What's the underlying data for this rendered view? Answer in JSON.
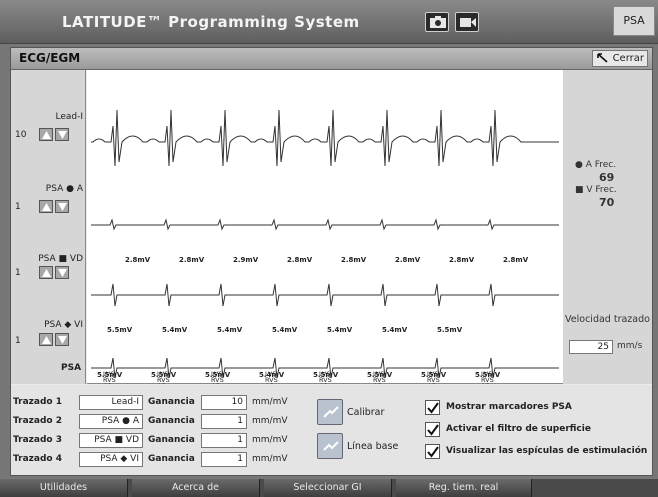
{
  "header": {
    "title": "LATITUDE™ Programming System",
    "camera_icon": "camera-icon",
    "video_icon": "video-camera-icon",
    "psa_button": "PSA"
  },
  "window": {
    "title": "ECG/EGM",
    "close_label": "Cerrar"
  },
  "channels": [
    {
      "label": "Lead-I",
      "gain": "10"
    },
    {
      "label": "PSA ● A",
      "gain": "1"
    },
    {
      "label": "PSA ■ VD",
      "gain": "1"
    },
    {
      "label": "PSA ◆ VI",
      "gain": "1"
    }
  ],
  "traces": {
    "psa_row_label": "PSA",
    "a_amplitudes": [
      "2.8mV",
      "2.8mV",
      "2.9mV",
      "2.8mV",
      "2.8mV",
      "2.8mV",
      "2.8mV",
      "2.8mV"
    ],
    "vd_amplitudes": [
      "5.5mV",
      "5.4mV",
      "5.4mV",
      "5.4mV",
      "5.4mV",
      "5.4mV",
      "5.5mV"
    ],
    "vi_amplitudes": [
      "5.5mV",
      "5.5mV",
      "5.5mV",
      "5.4mV",
      "5.5mV",
      "5.5mV",
      "5.5mV",
      "5.5mV"
    ],
    "markers": [
      [
        "LVS",
        "RVS",
        "AS"
      ],
      [
        "LVS",
        "RVS",
        "AS"
      ],
      [
        "LVS",
        "RVS",
        "AS"
      ],
      [
        "LVS",
        "RVS",
        "AS"
      ],
      [
        "LVS",
        "RVS",
        "AS"
      ],
      [
        "LVS",
        "RVS",
        "AS"
      ],
      [
        "LVS",
        "RVS",
        "AS"
      ],
      [
        "LVS",
        "RVS",
        "AS"
      ]
    ]
  },
  "rates": {
    "a_label": "● A Frec.",
    "a_value": "69",
    "v_label": "■ V Frec.",
    "v_value": "70"
  },
  "speed": {
    "label": "Velocidad trazado",
    "value": "25",
    "unit": "mm/s"
  },
  "controls": {
    "gain_label": "Ganancia",
    "gain_unit": "mm/mV",
    "rows": [
      {
        "label": "Trazado 1",
        "source": "Lead-I",
        "gain": "10"
      },
      {
        "label": "Trazado 2",
        "source": "PSA ● A",
        "gain": "1"
      },
      {
        "label": "Trazado 3",
        "source": "PSA ■ VD",
        "gain": "1"
      },
      {
        "label": "Trazado 4",
        "source": "PSA ◆ VI",
        "gain": "1"
      }
    ],
    "calibrate_label": "Calibrar",
    "baseline_label": "Línea base",
    "checkboxes": [
      {
        "label": "Mostrar marcadores PSA",
        "checked": true
      },
      {
        "label": "Activar el filtro de superficie",
        "checked": true
      },
      {
        "label": "Visualizar las espículas de estimulación",
        "checked": true
      }
    ]
  },
  "tabs": [
    "Utilidades",
    "Acerca de",
    "Seleccionar GI",
    "Reg. tiem. real"
  ]
}
